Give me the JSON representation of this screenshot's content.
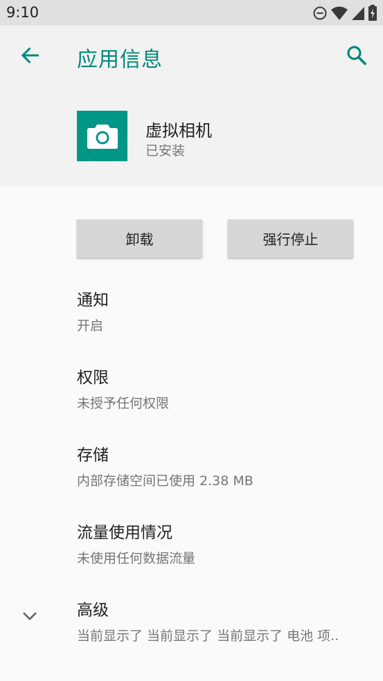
{
  "status_bar": {
    "time": "9:10",
    "icons": [
      "dnd-icon",
      "wifi-icon",
      "signal-icon",
      "battery-charging-icon"
    ]
  },
  "app_bar": {
    "title": "应用信息",
    "back_icon": "arrow-back-icon",
    "search_icon": "search-icon"
  },
  "app": {
    "name": "虚拟相机",
    "status": "已安装",
    "icon": "camera-icon",
    "icon_color": "#009688"
  },
  "buttons": {
    "uninstall": "卸载",
    "force_stop": "强行停止"
  },
  "settings": [
    {
      "title": "通知",
      "summary": "开启"
    },
    {
      "title": "权限",
      "summary": "未授予任何权限"
    },
    {
      "title": "存储",
      "summary": "内部存储空间已使用 2.38 MB"
    },
    {
      "title": "流量使用情况",
      "summary": "未使用任何数据流量"
    },
    {
      "title": "高级",
      "summary": "当前显示了 当前显示了 当前显示了 电池 项.."
    }
  ],
  "colors": {
    "accent": "#00897b",
    "background": "#fafafa",
    "header_background": "#f2f2f2",
    "status_bar": "#e0e0e0"
  }
}
